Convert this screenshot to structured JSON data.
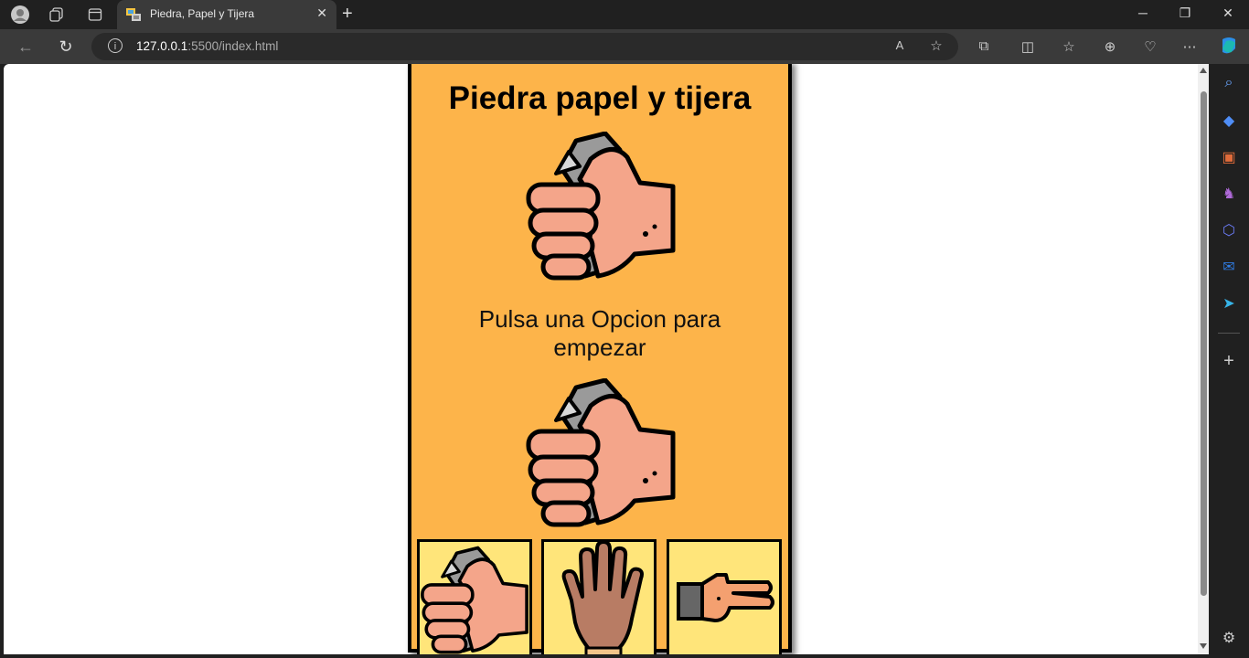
{
  "browser": {
    "tab_title": "Piedra, Papel y Tijera",
    "url_host": "127.0.0.1",
    "url_rest": ":5500/index.html"
  },
  "game": {
    "title": "Piedra papel y tijera",
    "message": "Pulsa una Opcion para empezar",
    "computer_choice_icon": "rock-fist-icon",
    "player_choice_icon": "rock-fist-icon",
    "options": [
      {
        "name": "piedra",
        "icon": "rock-fist-icon"
      },
      {
        "name": "papel",
        "icon": "open-hand-icon"
      },
      {
        "name": "tijera",
        "icon": "scissors-hand-icon"
      }
    ],
    "colors": {
      "panel": "#FDB44A",
      "option_bg": "#FFE57A",
      "skin": "#F4A58A"
    }
  }
}
